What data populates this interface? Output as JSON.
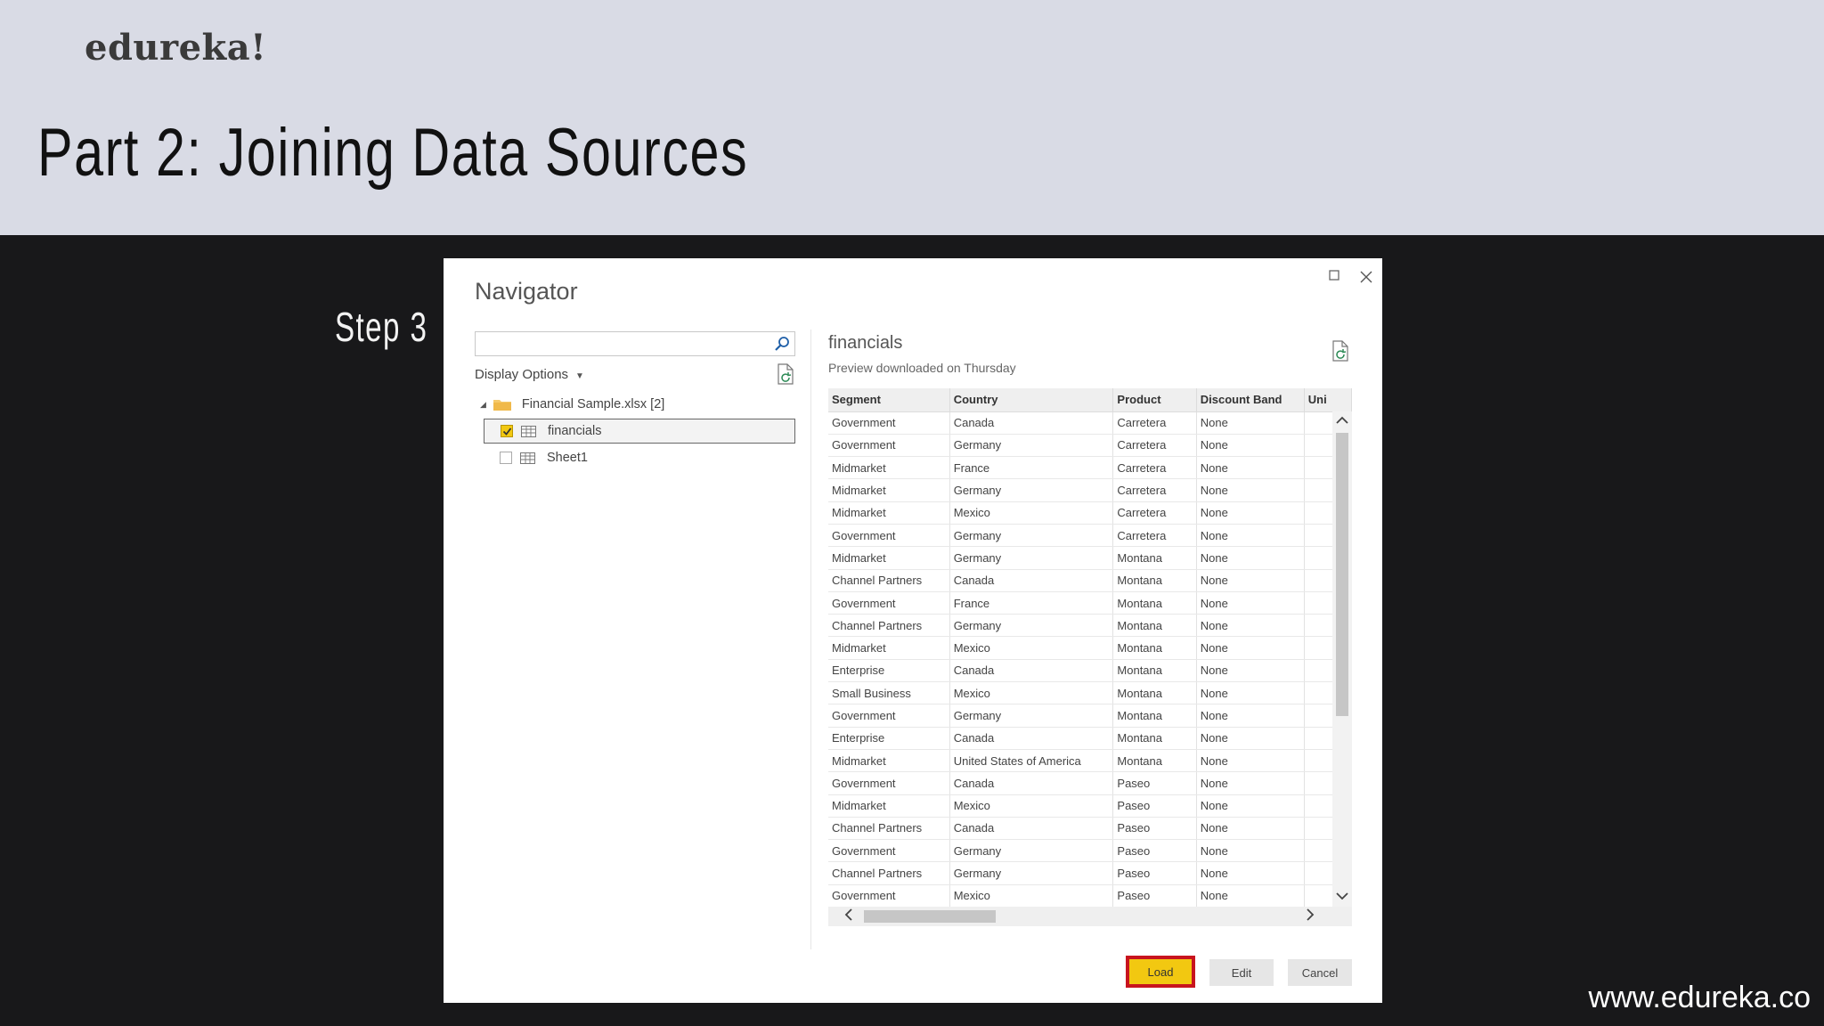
{
  "slide": {
    "brand": "edureka!",
    "title": "Part 2: Joining Data Sources",
    "step": "Step 3",
    "footer_url": "www.edureka.co"
  },
  "dialog": {
    "title": "Navigator",
    "search": {
      "value": "",
      "placeholder": ""
    },
    "display_options_label": "Display Options",
    "tree": {
      "root_label": "Financial Sample.xlsx [2]",
      "items": [
        {
          "label": "financials",
          "checked": true,
          "selected": true
        },
        {
          "label": "Sheet1",
          "checked": false,
          "selected": false
        }
      ]
    },
    "preview": {
      "title": "financials",
      "subtitle": "Preview downloaded on Thursday",
      "columns": [
        "Segment",
        "Country",
        "Product",
        "Discount Band",
        "Uni"
      ],
      "rows": [
        [
          "Government",
          "Canada",
          "Carretera",
          "None"
        ],
        [
          "Government",
          "Germany",
          "Carretera",
          "None"
        ],
        [
          "Midmarket",
          "France",
          "Carretera",
          "None"
        ],
        [
          "Midmarket",
          "Germany",
          "Carretera",
          "None"
        ],
        [
          "Midmarket",
          "Mexico",
          "Carretera",
          "None"
        ],
        [
          "Government",
          "Germany",
          "Carretera",
          "None"
        ],
        [
          "Midmarket",
          "Germany",
          "Montana",
          "None"
        ],
        [
          "Channel Partners",
          "Canada",
          "Montana",
          "None"
        ],
        [
          "Government",
          "France",
          "Montana",
          "None"
        ],
        [
          "Channel Partners",
          "Germany",
          "Montana",
          "None"
        ],
        [
          "Midmarket",
          "Mexico",
          "Montana",
          "None"
        ],
        [
          "Enterprise",
          "Canada",
          "Montana",
          "None"
        ],
        [
          "Small Business",
          "Mexico",
          "Montana",
          "None"
        ],
        [
          "Government",
          "Germany",
          "Montana",
          "None"
        ],
        [
          "Enterprise",
          "Canada",
          "Montana",
          "None"
        ],
        [
          "Midmarket",
          "United States of America",
          "Montana",
          "None"
        ],
        [
          "Government",
          "Canada",
          "Paseo",
          "None"
        ],
        [
          "Midmarket",
          "Mexico",
          "Paseo",
          "None"
        ],
        [
          "Channel Partners",
          "Canada",
          "Paseo",
          "None"
        ],
        [
          "Government",
          "Germany",
          "Paseo",
          "None"
        ],
        [
          "Channel Partners",
          "Germany",
          "Paseo",
          "None"
        ],
        [
          "Government",
          "Mexico",
          "Paseo",
          "None"
        ]
      ]
    },
    "buttons": {
      "load": "Load",
      "edit": "Edit",
      "cancel": "Cancel"
    },
    "colors": {
      "accent_load": "#f2c811",
      "highlight_border": "#c8141e",
      "check": "#f2c811"
    },
    "icons": {
      "search": "search-icon",
      "refresh": "refresh-icon",
      "folder": "folder-icon",
      "table": "table-icon",
      "maximize": "maximize-icon",
      "close": "close-icon"
    }
  }
}
